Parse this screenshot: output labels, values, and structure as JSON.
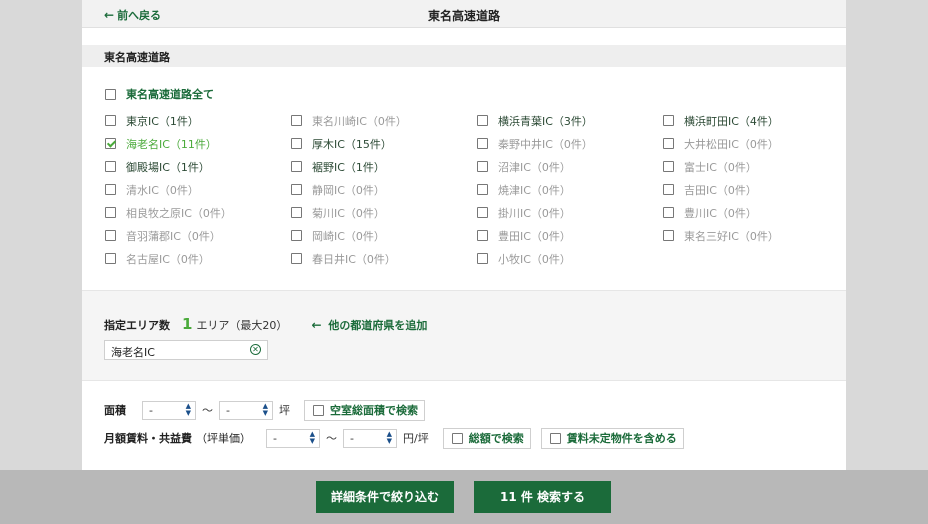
{
  "header": {
    "back_label": "前へ戻る",
    "title": "東名高速道路"
  },
  "section": {
    "title": "東名高速道路",
    "select_all_label": "東名高速道路全て"
  },
  "interchanges": [
    {
      "label": "東京IC（1件）",
      "count": 1,
      "checked": false
    },
    {
      "label": "東名川崎IC（0件）",
      "count": 0,
      "checked": false
    },
    {
      "label": "横浜青葉IC（3件）",
      "count": 3,
      "checked": false
    },
    {
      "label": "横浜町田IC（4件）",
      "count": 4,
      "checked": false
    },
    {
      "label": "海老名IC（11件）",
      "count": 11,
      "checked": true
    },
    {
      "label": "厚木IC（15件）",
      "count": 15,
      "checked": false
    },
    {
      "label": "秦野中井IC（0件）",
      "count": 0,
      "checked": false
    },
    {
      "label": "大井松田IC（0件）",
      "count": 0,
      "checked": false
    },
    {
      "label": "御殿場IC（1件）",
      "count": 1,
      "checked": false
    },
    {
      "label": "裾野IC（1件）",
      "count": 1,
      "checked": false
    },
    {
      "label": "沼津IC（0件）",
      "count": 0,
      "checked": false
    },
    {
      "label": "富士IC（0件）",
      "count": 0,
      "checked": false
    },
    {
      "label": "清水IC（0件）",
      "count": 0,
      "checked": false
    },
    {
      "label": "静岡IC（0件）",
      "count": 0,
      "checked": false
    },
    {
      "label": "焼津IC（0件）",
      "count": 0,
      "checked": false
    },
    {
      "label": "吉田IC（0件）",
      "count": 0,
      "checked": false
    },
    {
      "label": "相良牧之原IC（0件）",
      "count": 0,
      "checked": false
    },
    {
      "label": "菊川IC（0件）",
      "count": 0,
      "checked": false
    },
    {
      "label": "掛川IC（0件）",
      "count": 0,
      "checked": false
    },
    {
      "label": "豊川IC（0件）",
      "count": 0,
      "checked": false
    },
    {
      "label": "音羽蒲郡IC（0件）",
      "count": 0,
      "checked": false
    },
    {
      "label": "岡崎IC（0件）",
      "count": 0,
      "checked": false
    },
    {
      "label": "豊田IC（0件）",
      "count": 0,
      "checked": false
    },
    {
      "label": "東名三好IC（0件）",
      "count": 0,
      "checked": false
    },
    {
      "label": "名古屋IC（0件）",
      "count": 0,
      "checked": false
    },
    {
      "label": "春日井IC（0件）",
      "count": 0,
      "checked": false
    },
    {
      "label": "小牧IC（0件）",
      "count": 0,
      "checked": false
    }
  ],
  "area": {
    "label": "指定エリア数",
    "count": "1",
    "unit": "エリア（最大20）",
    "add_label": "他の都道府県を追加",
    "selected_chip": "海老名IC"
  },
  "filters": {
    "area_label": "面積",
    "area_from": "-",
    "area_to": "-",
    "area_tilde": "〜",
    "area_unit": "坪",
    "vacant_label": "空室総面積で検索",
    "rent_label": "月額賃料・共益費",
    "rent_sub": "（坪単価）",
    "rent_from": "-",
    "rent_to": "-",
    "rent_tilde": "〜",
    "rent_unit": "円/坪",
    "total_label": "総額で検索",
    "undetermined_label": "賃料未定物件を含める"
  },
  "footer": {
    "refine_label": "詳細条件で絞り込む",
    "search_label": "11 件 検索する"
  },
  "colors": {
    "brand_green": "#1b6b3a",
    "accent_green": "#4aaa3a"
  }
}
